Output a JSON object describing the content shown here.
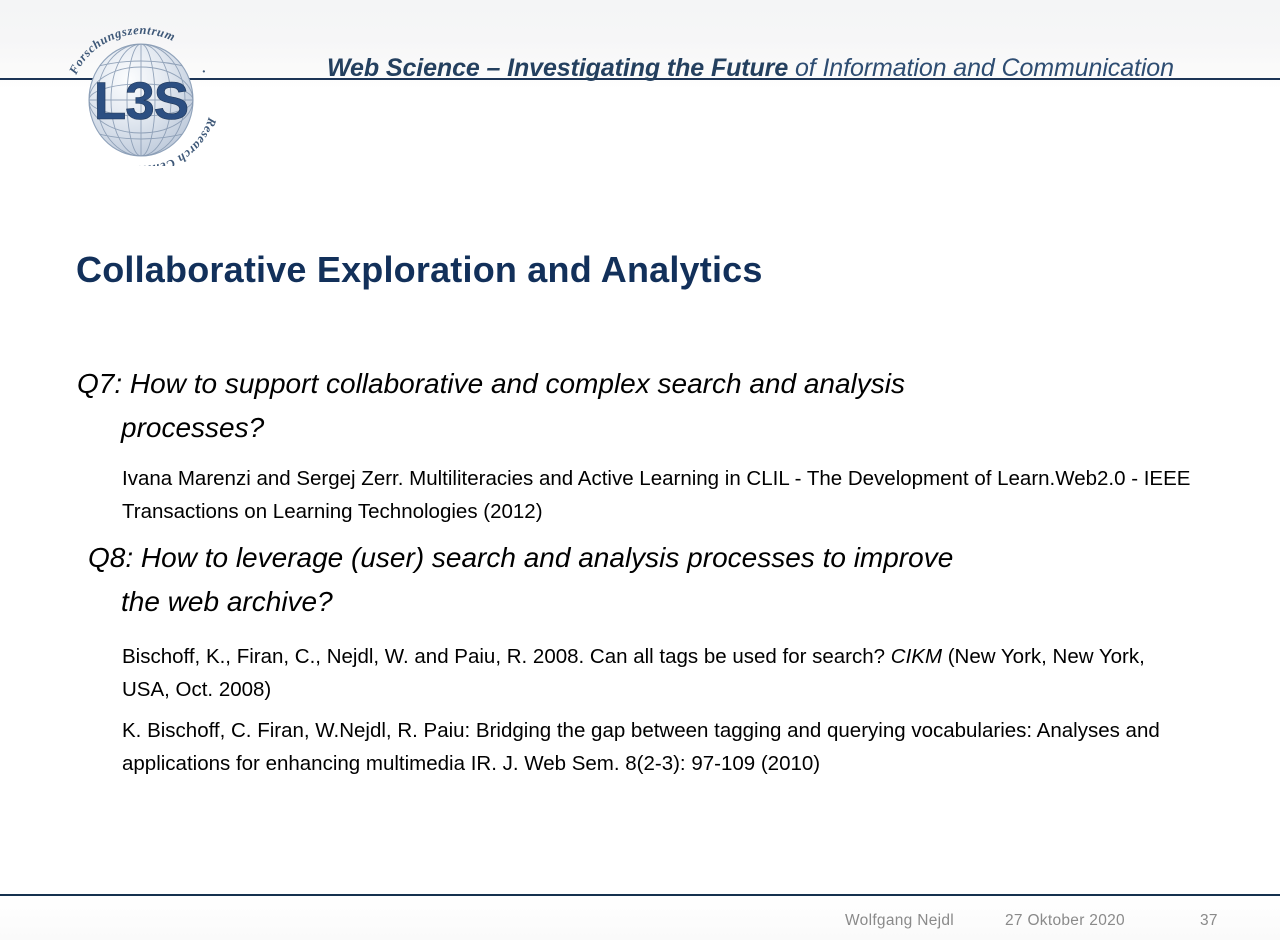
{
  "header": {
    "banner_strong": "Web Science – Investigating the Future",
    "banner_light": " of Information and Communication",
    "logo_name": "l3s-logo",
    "logo_wordmark": "L3S",
    "logo_ring_text": "Forschungszentrum · Research Center"
  },
  "slide": {
    "title": "Collaborative Exploration and Analytics"
  },
  "content": {
    "q7": {
      "line1": "Q7: How to support collaborative and complex search and analysis",
      "line2": "processes?"
    },
    "q7_citation": "Ivana Marenzi and Sergej Zerr. Multiliteracies and Active Learning in CLIL - The Development of Learn.Web2.0 - IEEE Transactions on Learning Technologies (2012)",
    "q8": {
      "line1": "Q8: How to leverage (user) search and analysis processes to improve",
      "line2": "the web archive?"
    },
    "q8_citation_1_pre": "Bischoff, K., Firan, C., Nejdl, W. and Paiu, R. 2008. Can all tags be used for search? ",
    "q8_citation_1_italic": "CIKM",
    "q8_citation_1_post": " (New York, New York, USA, Oct. 2008)",
    "q8_citation_2": "K. Bischoff, C. Firan, W.Nejdl, R. Paiu: Bridging the gap between tagging and querying vocabularies: Analyses and applications for enhancing multimedia IR. J. Web Sem. 8(2-3): 97-109 (2010)"
  },
  "footer": {
    "author": "Wolfgang Nejdl",
    "date": "27 Oktober 2020",
    "page_number": "37"
  },
  "colors": {
    "title_navy": "#12305a",
    "header_blue": "#2c4a6e",
    "rule_navy": "#1d3557",
    "footer_gray": "#8a8a8a",
    "body_black": "#000000"
  }
}
